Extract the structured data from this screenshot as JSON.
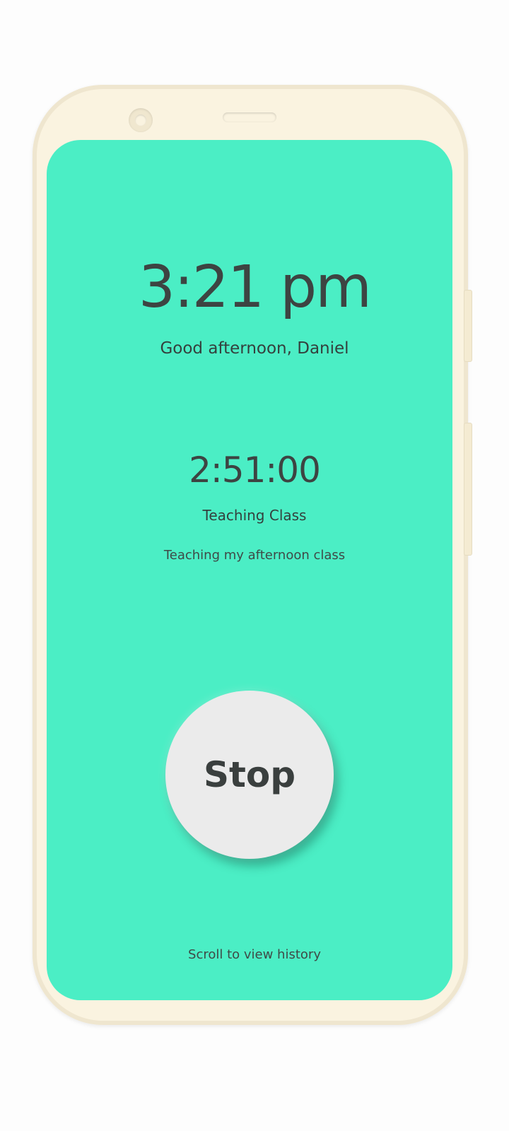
{
  "clock": {
    "time": "3:21 pm",
    "greeting": "Good afternoon, Daniel"
  },
  "timer": {
    "elapsed": "2:51:00",
    "activity_title": "Teaching Class",
    "activity_description": "Teaching my afternoon class"
  },
  "controls": {
    "stop_label": "Stop"
  },
  "footer": {
    "scroll_hint": "Scroll to view history"
  },
  "colors": {
    "screen_background": "#4beec5",
    "phone_body": "#faf3e0",
    "button_background": "#ebebeb",
    "text_primary": "#3d4442"
  }
}
